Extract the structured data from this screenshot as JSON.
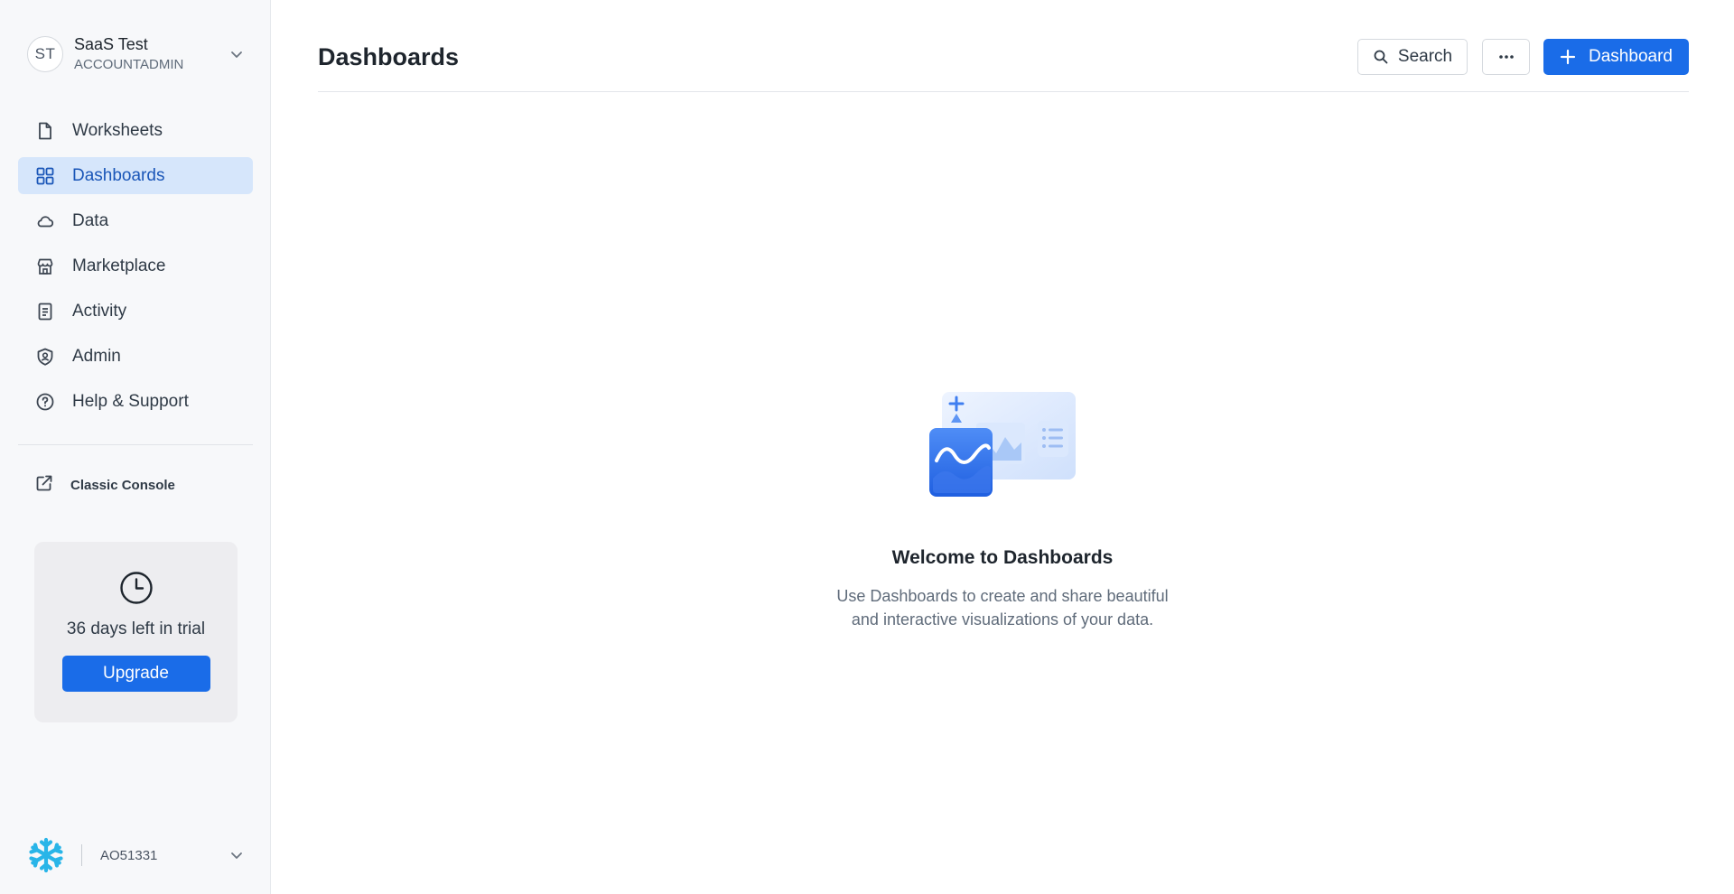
{
  "account": {
    "initials": "ST",
    "name": "SaaS Test",
    "role": "ACCOUNTADMIN"
  },
  "sidebar": {
    "items": [
      {
        "label": "Worksheets",
        "icon": "document-icon"
      },
      {
        "label": "Dashboards",
        "icon": "grid-icon",
        "active": true
      },
      {
        "label": "Data",
        "icon": "cloud-icon"
      },
      {
        "label": "Marketplace",
        "icon": "storefront-icon"
      },
      {
        "label": "Activity",
        "icon": "activity-log-icon"
      },
      {
        "label": "Admin",
        "icon": "shield-icon"
      },
      {
        "label": "Help & Support",
        "icon": "help-circle-icon"
      }
    ],
    "classic_console": "Classic Console"
  },
  "trial": {
    "text": "36 days left in trial",
    "upgrade_label": "Upgrade"
  },
  "footer": {
    "account_id": "AO51331"
  },
  "header": {
    "title": "Dashboards",
    "search_label": "Search",
    "more_label": "···",
    "new_dashboard_label": "Dashboard"
  },
  "empty_state": {
    "title": "Welcome to Dashboards",
    "desc_line1": "Use Dashboards to create and share beautiful",
    "desc_line2": "and interactive visualizations of your data."
  },
  "colors": {
    "accent": "#1a6ce8",
    "active_nav_bg": "#d6e6fb",
    "active_nav_text": "#1a56b8",
    "sidebar_bg": "#f7f8fa",
    "snowflake": "#29b5e8"
  }
}
